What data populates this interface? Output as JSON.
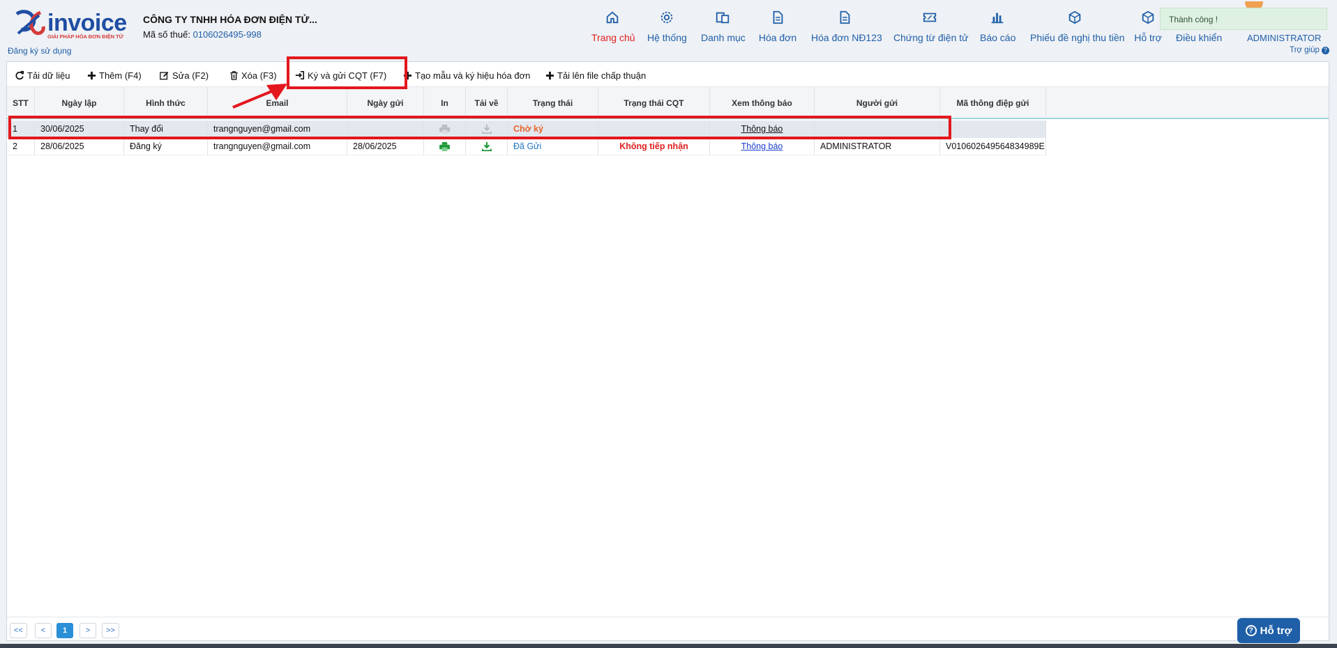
{
  "header": {
    "logo_text": "invoice",
    "logo_tagline": "GIẢI PHÁP HÓA ĐƠN ĐIỆN TỬ",
    "register_link": "Đăng ký sử dụng",
    "company_name": "CÔNG TY TNHH HÓA ĐƠN ĐIỆN TỬ...",
    "tax_label": "Mã số thuế:",
    "tax_value": "0106026495-998",
    "admin": "ADMINISTRATOR",
    "help": "Trợ giúp"
  },
  "nav": [
    {
      "label": "Trang chủ",
      "icon": "home-icon",
      "active": true
    },
    {
      "label": "Hệ thống",
      "icon": "gear-icon"
    },
    {
      "label": "Danh mục",
      "icon": "folder-doc-icon"
    },
    {
      "label": "Hóa đơn",
      "icon": "document-icon"
    },
    {
      "label": "Hóa đơn NĐ123",
      "icon": "document-icon"
    },
    {
      "label": "Chứng từ điện tử",
      "icon": "ticket-icon"
    },
    {
      "label": "Báo cáo",
      "icon": "bar-chart-icon"
    },
    {
      "label": "Phiếu đề nghị thu tiền",
      "icon": "box-icon"
    },
    {
      "label": "Hỗ trợ",
      "icon": "box-icon"
    },
    {
      "label": "Điều khiển",
      "icon": ""
    }
  ],
  "toast": "Thành công !",
  "toolbar": {
    "reload": "Tải dữ liệu",
    "add": "Thêm (F4)",
    "edit": "Sửa (F2)",
    "delete": "Xóa (F3)",
    "sign_send": "Ký và gửi CQT (F7)",
    "create_template": "Tạo mẫu và ký hiệu hóa đơn",
    "upload": "Tải lên file chấp thuận"
  },
  "table": {
    "columns": [
      "STT",
      "Ngày lập",
      "Hình thức",
      "Email",
      "Ngày gửi",
      "In",
      "Tải về",
      "Trạng thái",
      "Trạng thái CQT",
      "Xem thông báo",
      "Người gửi",
      "Mã thông điệp gửi"
    ],
    "rows": [
      {
        "stt": "1",
        "date": "30/06/2025",
        "type": "Thay đổi",
        "email": "trangnguyen@gmail.com",
        "sent_date": "",
        "status": "Chờ ký",
        "cqt_status": "",
        "notice": "Thông báo",
        "sender": "",
        "msg_code": ""
      },
      {
        "stt": "2",
        "date": "28/06/2025",
        "type": "Đăng ký",
        "email": "trangnguyen@gmail.com",
        "sent_date": "28/06/2025",
        "status": "Đã Gửi",
        "cqt_status": "Không tiếp nhận",
        "notice": "Thông báo",
        "sender": "ADMINISTRATOR",
        "msg_code": "V0106026495648349​89E"
      }
    ]
  },
  "pager": {
    "first": "<<",
    "prev": "<",
    "current": "1",
    "next": ">",
    "last": ">>"
  },
  "support": "Hỗ trợ",
  "colors": {
    "accent": "#1f5fa8",
    "highlight": "#e3171e",
    "waiting": "#e8642a",
    "reject": "#e02020"
  }
}
